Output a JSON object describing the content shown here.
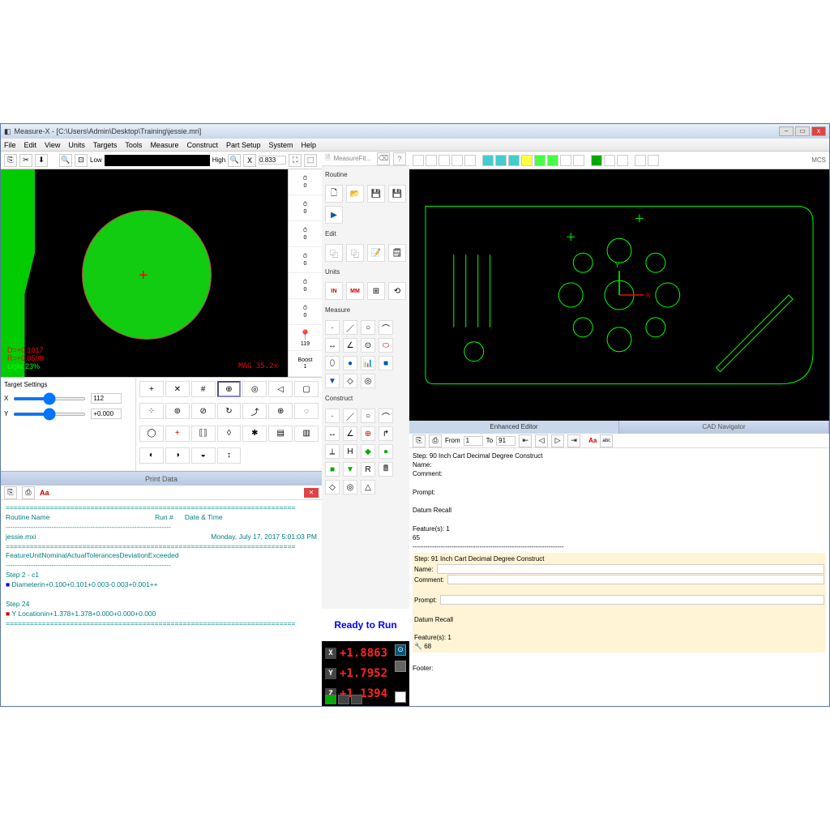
{
  "title": "Measure-X - [C:\\Users\\Admin\\Desktop\\Training\\jessie.mri]",
  "menus": [
    "File",
    "Edit",
    "View",
    "Units",
    "Targets",
    "Tools",
    "Measure",
    "Construct",
    "Part Setup",
    "System",
    "Help"
  ],
  "zoom_low": "Low",
  "zoom_high": "High",
  "zoom_value": "0.833",
  "zoom_units": "X",
  "overlay": {
    "d": "D=+0.1017",
    "r": "R=+0.0508",
    "light": "Light 23%",
    "mag": "MAG 35.2x"
  },
  "timers": [
    {
      "icon": "⏱",
      "val": "0"
    },
    {
      "icon": "⏱",
      "val": "0"
    },
    {
      "icon": "⏱",
      "val": "0"
    },
    {
      "icon": "⏱",
      "val": "0"
    },
    {
      "icon": "⏱",
      "val": "0"
    },
    {
      "icon": "⏱",
      "val": "0"
    }
  ],
  "timer_light": "119",
  "boost_label": "Boost",
  "boost_value": "1",
  "target_settings_label": "Target Settings",
  "target_x": "112",
  "target_y": "+0.000",
  "print_data_label": "Print Data",
  "print": {
    "routine_name_label": "Routine Name",
    "run_label": "Run #",
    "date_label": "Date & Time",
    "routine_file": "jessie.mxi",
    "date_value": "Monday, July 17, 2017 5:01:03 PM",
    "headers": [
      "Feature",
      "Unit",
      "Nominal",
      "Actual",
      "Tolerances",
      "",
      "Deviation",
      "Exceeded"
    ],
    "step2": "Step 2 - c1",
    "diameter_label": "Diameter",
    "diam_unit": "in",
    "diam_nom": "+0.100",
    "diam_act": "+0.101",
    "diam_tolp": "+0.003",
    "diam_tolm": "-0.003",
    "diam_dev": "+0.001",
    "diam_exc": "++",
    "step24": "Step 24",
    "yloc_label": "Y Location",
    "yloc_unit": "in",
    "yloc_nom": "+1.378",
    "yloc_act": "+1.378",
    "yloc_tolp": "+0.000",
    "yloc_tolm": "+0.000",
    "yloc_dev": "+0.000"
  },
  "measurefit_label": "MeasureFit...",
  "groups": {
    "routine": "Routine",
    "edit": "Edit",
    "units": "Units",
    "measure": "Measure",
    "construct": "Construct"
  },
  "units_in": "IN",
  "units_mm": "MM",
  "status": "Ready to Run",
  "dro": {
    "x": "+1.8863",
    "y": "+1.7952",
    "z": "+1.1394"
  },
  "tabs": {
    "editor": "Enhanced Editor",
    "cad": "CAD Navigator"
  },
  "editor": {
    "from_label": "From",
    "to_label": "To",
    "from": "1",
    "to": "91",
    "step90_header": "Step:  90   Inch   Cart      Decimal Degree   Construct",
    "name_label": "Name:",
    "comment_label": "Comment:",
    "prompt_label": "Prompt:",
    "datum_recall": "Datum Recall",
    "features_label": "Feature(s): 1",
    "feature_num": "65",
    "step91_header": "Step:  91   Inch   Cart      Decimal Degree   Construct",
    "feature_num2": "68",
    "footer_label": "Footer:"
  },
  "mcs_label": "MCS"
}
